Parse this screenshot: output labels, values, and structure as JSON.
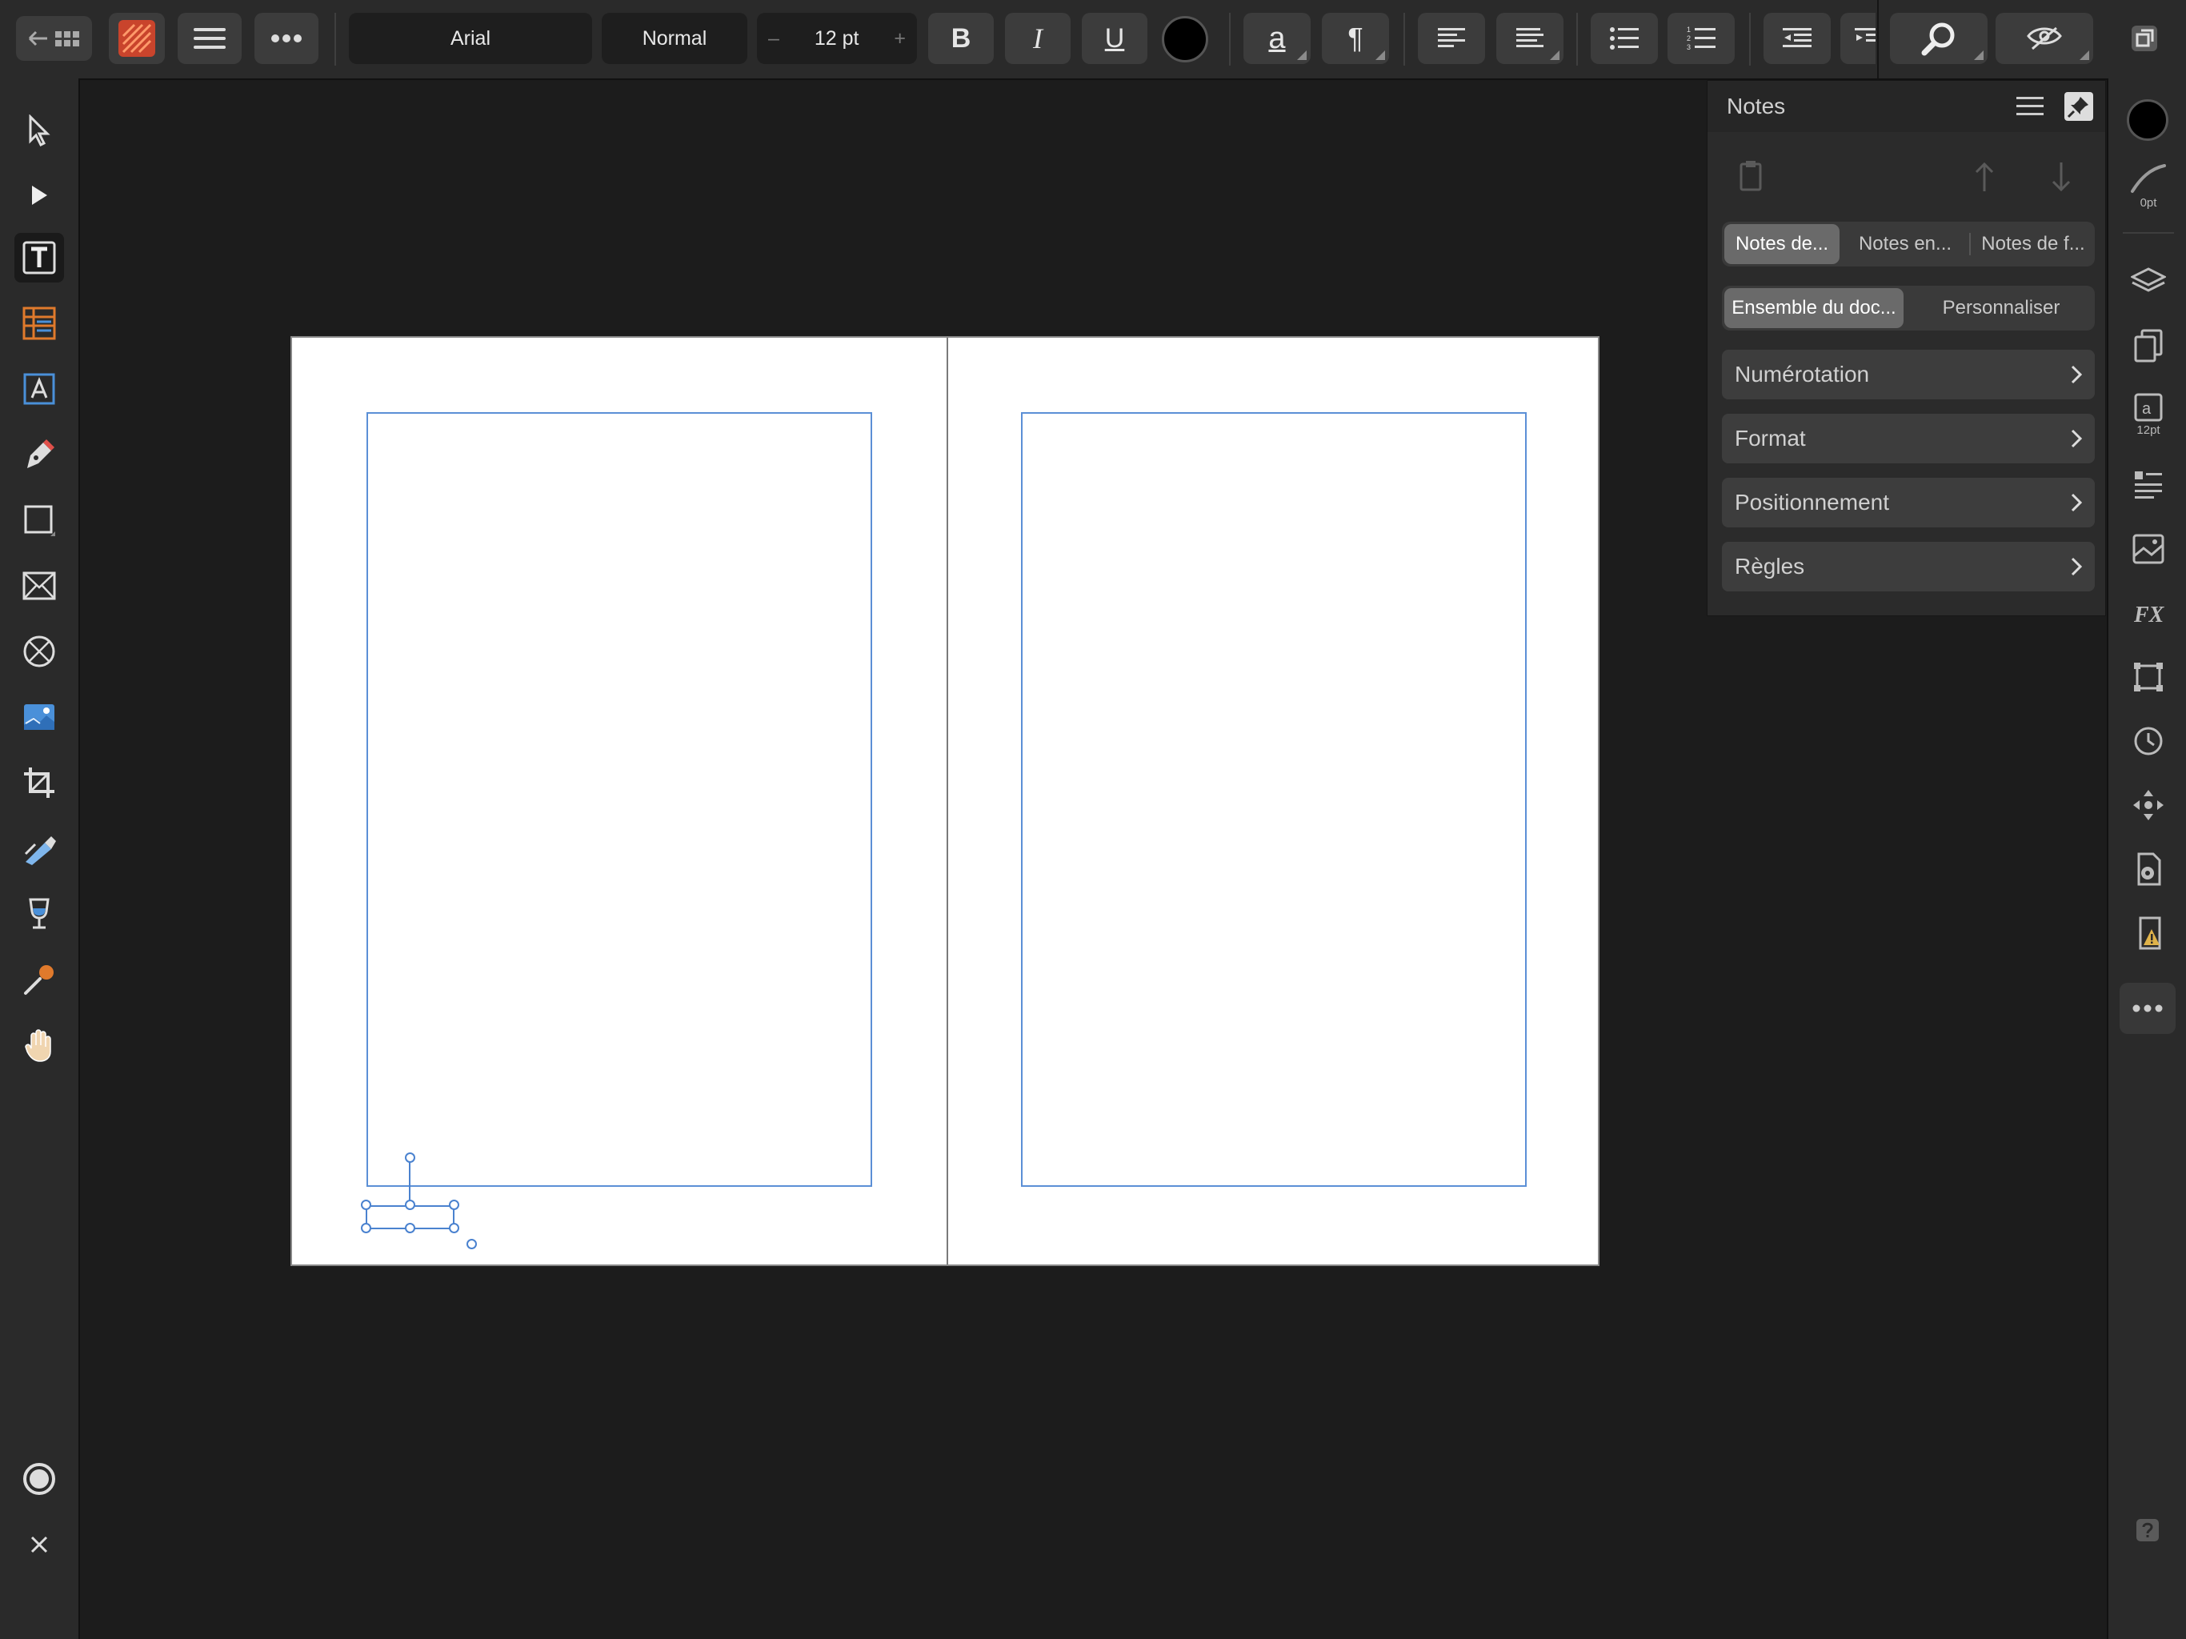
{
  "toolbar": {
    "font_family": "Arial",
    "font_style": "Normal",
    "font_size": "12 pt",
    "size_minus": "–",
    "size_plus": "+",
    "bold_label": "B",
    "italic_label": "I",
    "underline_label": "U",
    "text_style_label": "a",
    "pilcrow": "¶",
    "text_color": "#000000"
  },
  "notes_panel": {
    "title": "Notes",
    "note_type_tabs": [
      "Notes de...",
      "Notes en...",
      "Notes de f..."
    ],
    "selected_note_type": 0,
    "scope_tabs": [
      "Ensemble du doc...",
      "Personnaliser"
    ],
    "selected_scope": 0,
    "sections": [
      "Numérotation",
      "Format",
      "Positionnement",
      "Règles"
    ]
  },
  "right_studio": {
    "stroke_width": "0pt",
    "text_size": "12pt",
    "fill_color": "#000000"
  },
  "colors": {
    "app_icon": "#c9442c",
    "selection_blue": "#4a82cf",
    "warning_icon": "#e0b34a"
  }
}
